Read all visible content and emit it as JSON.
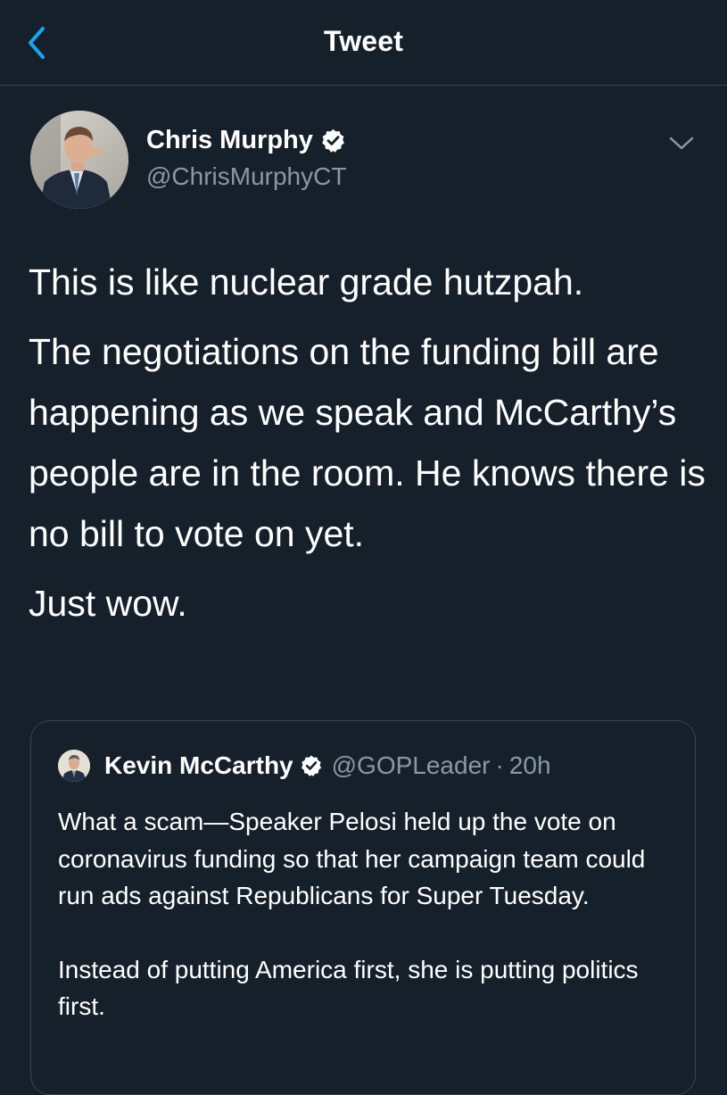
{
  "header": {
    "title": "Tweet",
    "back_icon": "chevron-left-icon"
  },
  "colors": {
    "background": "#15202b",
    "accent": "#1da1f2",
    "secondary_text": "#8899a6",
    "border": "#38444d"
  },
  "tweet": {
    "author_name": "Chris Murphy",
    "author_handle": "@ChrisMurphyCT",
    "verified": true,
    "menu_icon": "chevron-down-icon",
    "paragraphs": [
      "This is like nuclear grade hutzpah.",
      "The negotiations on the funding bill are happening as we speak and McCarthy’s people are in the room. He knows there is no bill to vote on yet.",
      "Just wow."
    ]
  },
  "quoted_tweet": {
    "author_name": "Kevin McCarthy",
    "author_handle": "@GOPLeader",
    "separator": "·",
    "time": "20h",
    "verified": true,
    "paragraphs": [
      "What a scam—Speaker Pelosi held up the vote on coronavirus funding so that her campaign team could run ads against Republicans for Super Tuesday.",
      "Instead of putting America first, she is putting politics first."
    ]
  }
}
